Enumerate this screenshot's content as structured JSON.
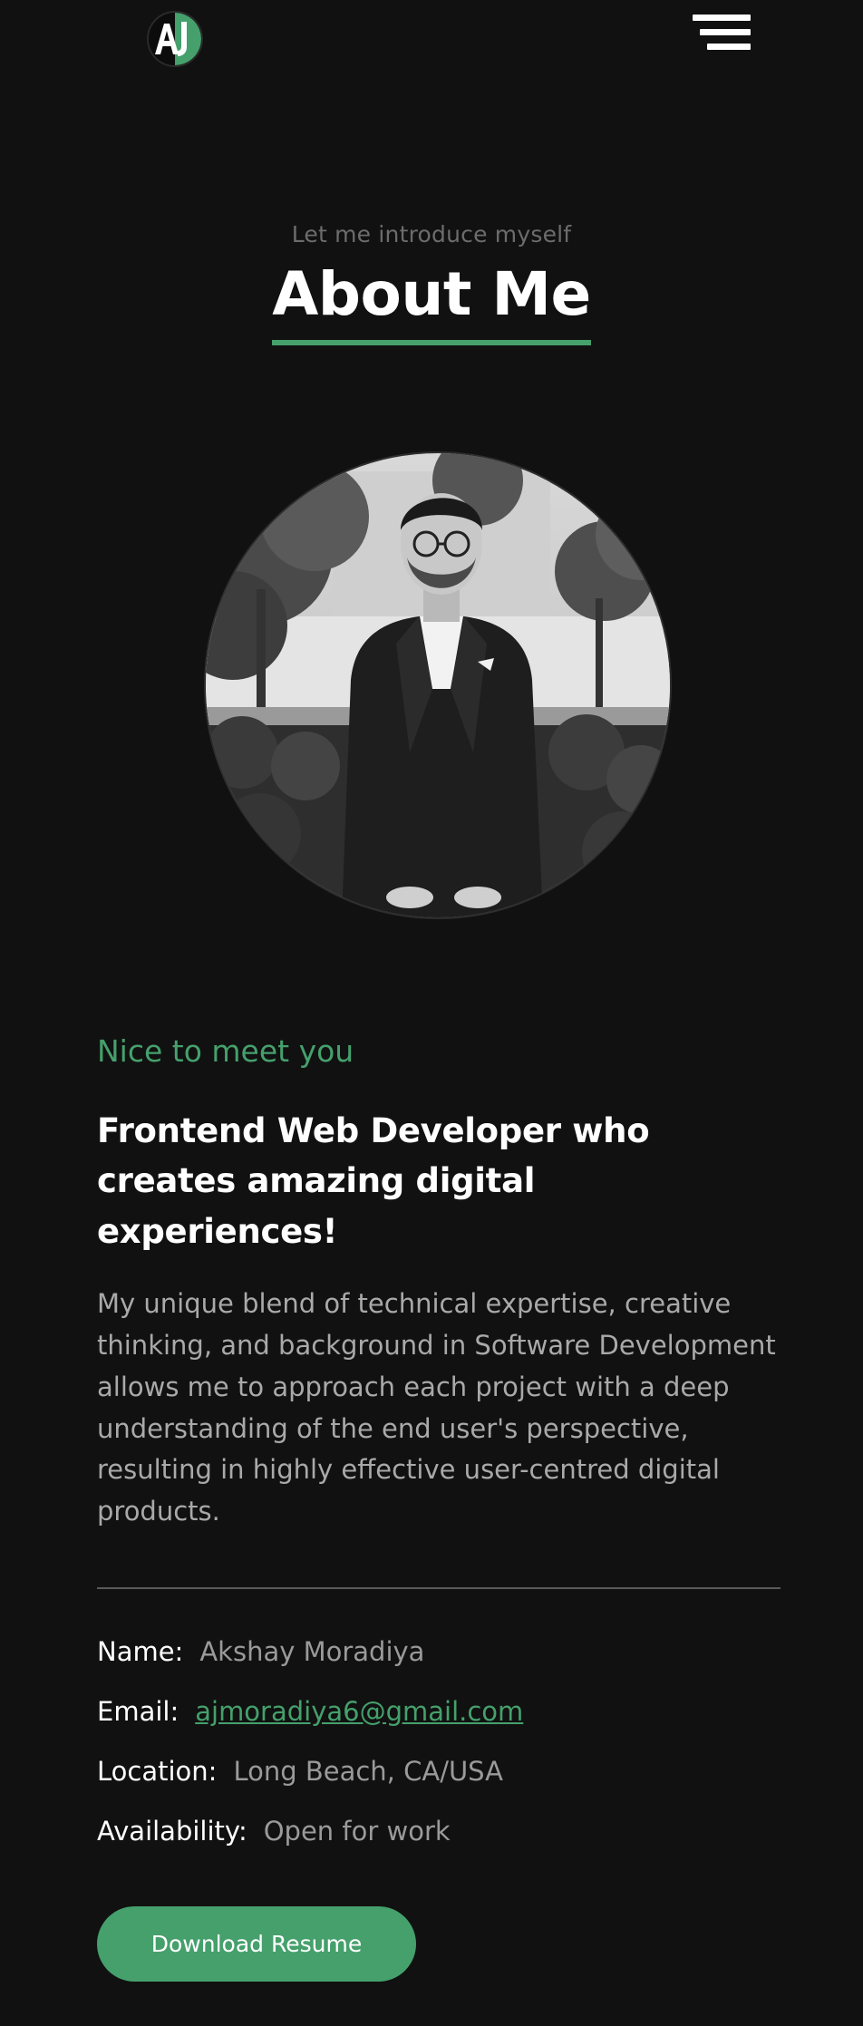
{
  "header": {
    "logo_icon": "aj-logo-icon",
    "menu_icon": "hamburger-menu-icon"
  },
  "about": {
    "eyebrow": "Let me introduce myself",
    "title": "About Me"
  },
  "portrait": {
    "alt": "grayscale portrait of a man in a dark suit standing outdoors"
  },
  "intro": {
    "kicker": "Nice to meet you",
    "headline": "Frontend Web Developer who creates amazing digital experiences!",
    "bio": "My unique blend of technical expertise, creative thinking, and background in Software Development allows me to approach each project with a deep understanding of the end user's perspective, resulting in highly effective user-centred digital products."
  },
  "info": {
    "name_label": "Name:",
    "name_value": "Akshay Moradiya",
    "email_label": "Email:",
    "email_value": "ajmoradiya6@gmail.com",
    "location_label": "Location:",
    "location_value": "Long Beach, CA/USA",
    "availability_label": "Availability:",
    "availability_value": "Open for work"
  },
  "cta": {
    "download_label": "Download Resume"
  },
  "colors": {
    "background": "#111111",
    "accent": "#45a06c",
    "text_primary": "#ffffff",
    "text_muted": "#a9a9a9"
  }
}
